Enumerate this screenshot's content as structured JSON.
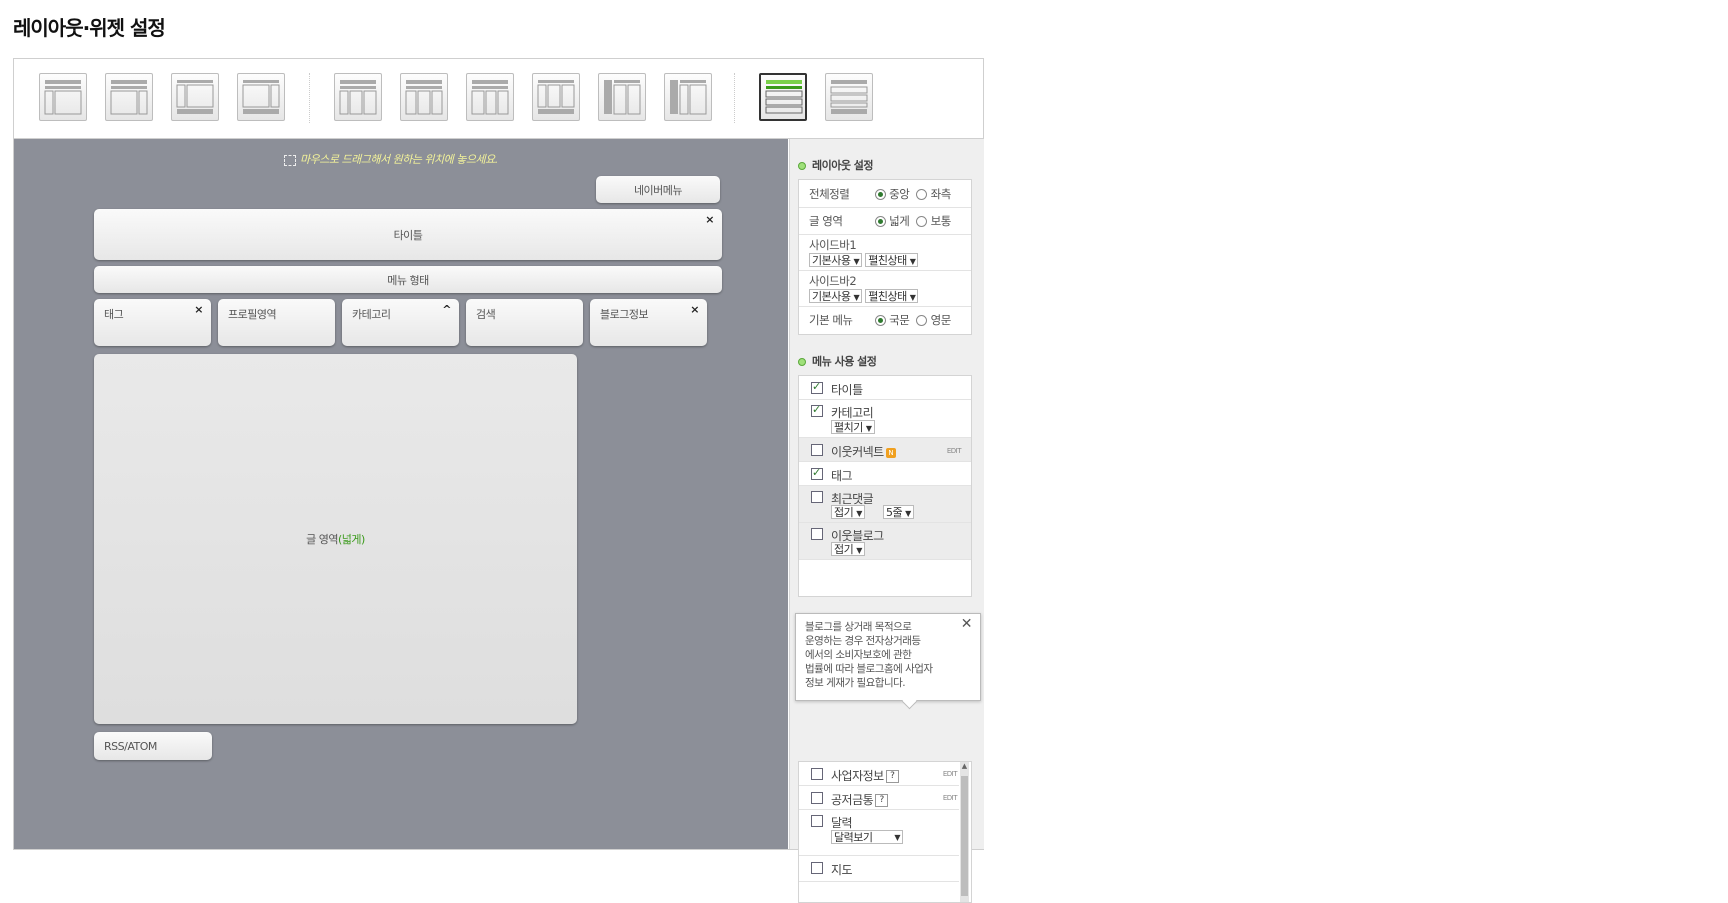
{
  "page": {
    "title": "레이아웃·위젯 설정"
  },
  "layout_templates": [
    {
      "name": "layout-1"
    },
    {
      "name": "layout-2"
    },
    {
      "name": "layout-3"
    },
    {
      "name": "layout-4"
    },
    {
      "name": "layout-5"
    },
    {
      "name": "layout-6"
    },
    {
      "name": "layout-7"
    },
    {
      "name": "layout-8"
    },
    {
      "name": "layout-9"
    },
    {
      "name": "layout-10"
    },
    {
      "name": "layout-11",
      "selected": true
    },
    {
      "name": "layout-12"
    }
  ],
  "canvas": {
    "hint": "마우스로 드래그해서 원하는 위치에 놓으세요.",
    "widgets": {
      "navermenu": "네이버메뉴",
      "title": "타이틀",
      "menu_type": "메뉴 형태",
      "tag": "태그",
      "profile": "프로필영역",
      "category": "카테고리",
      "search": "검색",
      "bloginfo": "블로그정보",
      "content_label": "글 영역",
      "content_mode": "(넓게)",
      "rss": "RSS/ATOM",
      "close_symbol": "×",
      "collapse_symbol": "^"
    }
  },
  "layout_settings": {
    "title": "레이아웃 설정",
    "align": {
      "label": "전체정렬",
      "options": [
        "중앙",
        "좌측"
      ],
      "selected": "중앙"
    },
    "text_area": {
      "label": "글 영역",
      "options": [
        "넓게",
        "보통"
      ],
      "selected": "넓게"
    },
    "sidebar1": {
      "label": "사이드바1",
      "use": "기본사용",
      "state": "펼친상태"
    },
    "sidebar2": {
      "label": "사이드바2",
      "use": "기본사용",
      "state": "펼친상태"
    },
    "menu_lang": {
      "label": "기본 메뉴",
      "options": [
        "국문",
        "영문"
      ],
      "selected": "국문"
    }
  },
  "menu_settings": {
    "title": "메뉴 사용 설정",
    "edit_label": "EDIT",
    "items": [
      {
        "label": "타이틀",
        "checked": true
      },
      {
        "label": "카테고리",
        "checked": true,
        "select": "펼치기"
      },
      {
        "label": "이웃커넥트",
        "checked": false,
        "badge": "N",
        "edit": true
      },
      {
        "label": "태그",
        "checked": true
      },
      {
        "label": "최근댓글",
        "checked": false,
        "select": "접기",
        "select2": "5줄"
      },
      {
        "label": "이웃블로그",
        "checked": false,
        "select": "접기"
      }
    ],
    "items_lower": [
      {
        "label": "사업자정보",
        "checked": false,
        "help": "?",
        "edit": true
      },
      {
        "label": "공저금통",
        "checked": false,
        "help": "?",
        "edit": true
      },
      {
        "label": "달력",
        "checked": false,
        "select": "달력보기"
      },
      {
        "label": "지도",
        "checked": false
      }
    ]
  },
  "tooltip": {
    "lines": [
      "블로그를 상거래 목적으로",
      "운영하는 경우 전자상거래등",
      "에서의 소비자보호에 관한",
      "법률에 따라 블로그홈에 사업자",
      "정보 게재가 필요합니다."
    ]
  },
  "colors": {
    "canvas_bg": "#8c8f98",
    "hint": "#f3f39a",
    "accent_green": "#3a9a1a"
  }
}
